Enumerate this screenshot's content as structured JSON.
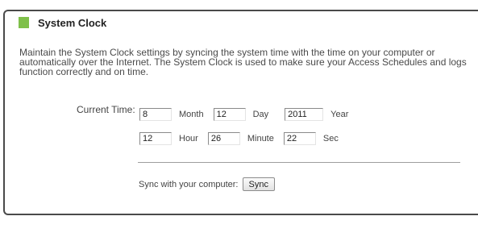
{
  "section": {
    "title": "System Clock",
    "description": "Maintain the System Clock settings by syncing the system time with the time on your computer or automatically over the Internet. The System Clock is used to make sure your Access Schedules and logs function correctly and on time."
  },
  "current_time": {
    "label": "Current Time:",
    "month": {
      "value": "8",
      "label": "Month"
    },
    "day": {
      "value": "12",
      "label": "Day"
    },
    "year": {
      "value": "2011",
      "label": "Year"
    },
    "hour": {
      "value": "12",
      "label": "Hour"
    },
    "minute": {
      "value": "26",
      "label": "Minute"
    },
    "second": {
      "value": "22",
      "label": "Sec"
    }
  },
  "sync": {
    "label": "Sync with your computer:",
    "button_label": "Sync"
  },
  "colors": {
    "accent": "#7fc04a",
    "border": "#4a4a4a"
  }
}
